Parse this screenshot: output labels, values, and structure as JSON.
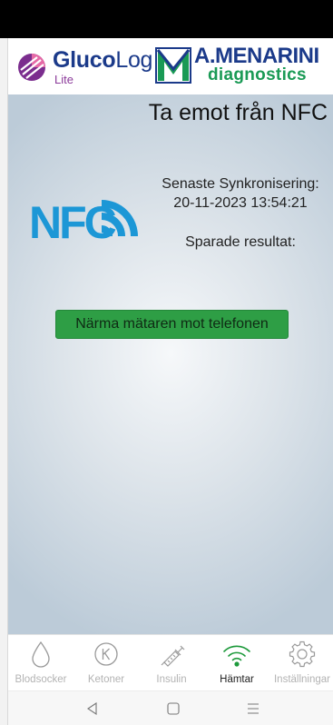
{
  "header": {
    "glucolog_bold": "Gluco",
    "glucolog_light": "Log",
    "glucolog_lite": "Lite",
    "menarini_title": "A.MENARINI",
    "menarini_sub": "diagnostics"
  },
  "main": {
    "title": "Ta emot från NFC",
    "nfc_logo_text": "NFC",
    "sync_label": "Senaste Synkronisering:",
    "sync_date": "20-11-2023 13:54:21",
    "saved_label": "Sparade resultat:",
    "nfc_button_label": "Närma mätaren mot telefonen"
  },
  "tabs": [
    {
      "label": "Blodsocker",
      "icon": "drop-icon",
      "active": false
    },
    {
      "label": "Ketoner",
      "icon": "ketone-k-icon",
      "active": false
    },
    {
      "label": "Insulin",
      "icon": "syringe-icon",
      "active": false
    },
    {
      "label": "Hämtar",
      "icon": "wifi-icon",
      "active": true
    },
    {
      "label": "Inställningar",
      "icon": "gear-icon",
      "active": false
    }
  ],
  "navbar": {
    "items": [
      "back-icon",
      "home-icon",
      "menu-icon"
    ]
  },
  "colors": {
    "brand_blue": "#1b3a8a",
    "brand_green": "#1a9a55",
    "button_green": "#2e9e45",
    "active_tab_green": "#1e9a3c",
    "nfc_blue": "#1c97d6"
  }
}
